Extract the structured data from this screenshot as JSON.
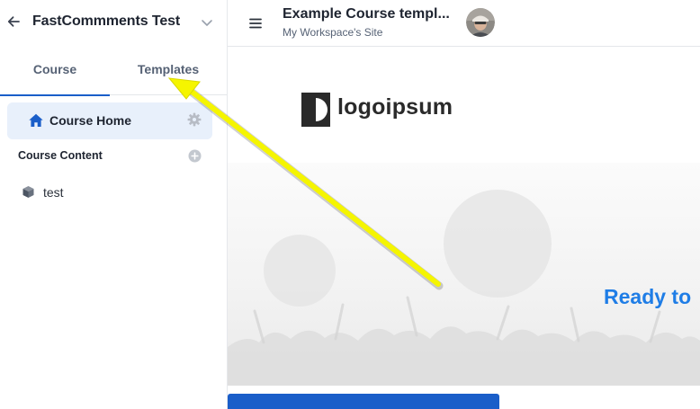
{
  "sidebar": {
    "project_title": "FastCommments Test",
    "tabs": [
      {
        "label": "Course",
        "active": true
      },
      {
        "label": "Templates",
        "active": false
      }
    ],
    "home_item": {
      "label": "Course Home",
      "icon": "home-icon"
    },
    "section_title": "Course Content",
    "content_items": [
      {
        "label": "test",
        "icon": "cube-icon"
      }
    ]
  },
  "topbar": {
    "course_title": "Example Course templ...",
    "site_name": "My Workspace's Site"
  },
  "canvas": {
    "logo_text": "logoipsum",
    "hero_heading": "Ready to"
  },
  "colors": {
    "accent": "#1a5ec9",
    "heading_blue": "#1f7de6",
    "active_item_bg": "#e8f0fb",
    "annotation_arrow": "#f5f500"
  }
}
